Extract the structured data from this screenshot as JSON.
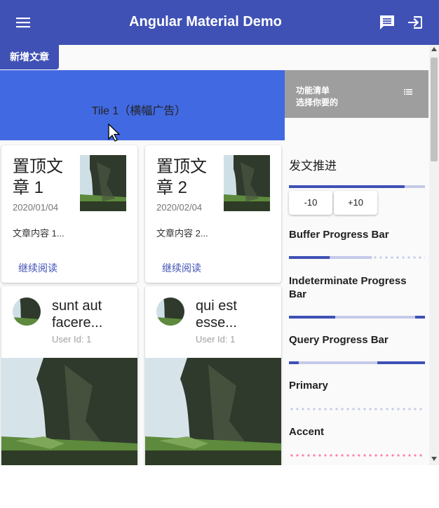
{
  "toolbar": {
    "title": "Angular Material Demo",
    "menu_icon": "menu-icon",
    "chat_icon": "chat-icon",
    "exit_icon": "exit-to-app-icon",
    "color": "#3f51b5"
  },
  "tabs": {
    "new_post": "新增文章"
  },
  "tiles": {
    "banner": "Tile 1（横幅广告）",
    "banner_color": "#4169e1",
    "function_list": {
      "line1": "功能清单",
      "line2": "选择你要的",
      "icon": "list-icon"
    }
  },
  "pinned_posts": [
    {
      "title": "置顶文章 1",
      "date": "2020/01/04",
      "content": "文章内容 1...",
      "link": "继续阅读"
    },
    {
      "title": "置顶文章 2",
      "date": "2020/02/04",
      "content": "文章内容 2...",
      "link": "继续阅读"
    }
  ],
  "posts": [
    {
      "title": "sunt aut facere...",
      "user": "User Id: 1"
    },
    {
      "title": "qui est esse...",
      "user": "User Id: 1"
    }
  ],
  "sidebar": {
    "publish_progress": {
      "label": "发文推进",
      "value": 0.85,
      "minus_button": "-10",
      "plus_button": "+10"
    },
    "buffer_progress": {
      "label": "Buffer Progress Bar",
      "value": 0.3,
      "buffer": 0.61
    },
    "indeterminate_progress": {
      "label": "Indeterminate Progress Bar"
    },
    "query_progress": {
      "label": "Query Progress Bar"
    },
    "primary": {
      "label": "Primary",
      "color": "#c5cae9"
    },
    "accent": {
      "label": "Accent",
      "color": "#ff80ab"
    }
  }
}
